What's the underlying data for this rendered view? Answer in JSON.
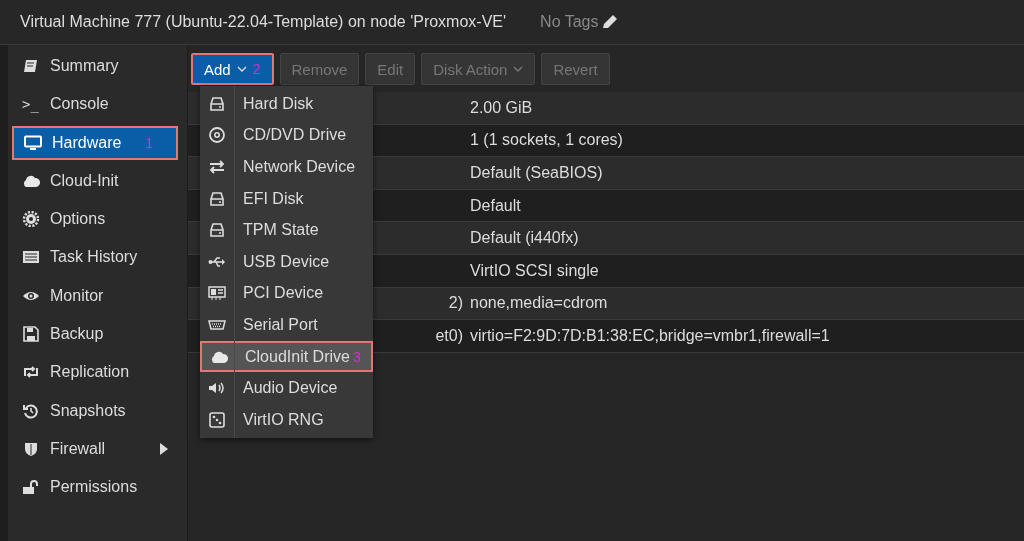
{
  "header": {
    "title": "Virtual Machine 777 (Ubuntu-22.04-Template) on node 'Proxmox-VE'",
    "tags": "No Tags"
  },
  "sidebar": {
    "items": [
      {
        "label": "Summary",
        "selected": false
      },
      {
        "label": ">_",
        "label2": "Console",
        "selected": false
      },
      {
        "label": "Hardware",
        "selected": true,
        "annotation": "1"
      },
      {
        "label": "Cloud-Init",
        "selected": false
      },
      {
        "label": "Options",
        "selected": false
      },
      {
        "label": "Task History",
        "selected": false
      },
      {
        "label": "Monitor",
        "selected": false
      },
      {
        "label": "Backup",
        "selected": false
      },
      {
        "label": "Replication",
        "selected": false
      },
      {
        "label": "Snapshots",
        "selected": false
      },
      {
        "label": "Firewall",
        "selected": false,
        "submenu": true
      },
      {
        "label": "Permissions",
        "selected": false
      }
    ]
  },
  "toolbar": {
    "buttons": [
      {
        "label": "Add",
        "kind": "primary",
        "dropdown": true,
        "disabled": false,
        "annotation": "2"
      },
      {
        "label": "Remove",
        "kind": "normal",
        "dropdown": false,
        "disabled": true
      },
      {
        "label": "Edit",
        "kind": "normal",
        "dropdown": false,
        "disabled": true
      },
      {
        "label": "Disk Action",
        "kind": "normal",
        "dropdown": true,
        "disabled": true
      },
      {
        "label": "Revert",
        "kind": "normal",
        "dropdown": false,
        "disabled": true
      }
    ]
  },
  "table": {
    "rows": [
      {
        "value": "2.00 GiB"
      },
      {
        "value": "1 (1 sockets, 1 cores)"
      },
      {
        "value": "Default (SeaBIOS)"
      },
      {
        "value": "Default"
      },
      {
        "value": "Default (i440fx)"
      },
      {
        "value": "VirtIO SCSI single"
      },
      {
        "column_1": "2)",
        "value": "none,media=cdrom"
      },
      {
        "column_1": "et0)",
        "value": "virtio=F2:9D:7D:B1:38:EC,bridge=vmbr1,firewall=1"
      }
    ]
  },
  "add_menu": {
    "items": [
      {
        "label": "Hard Disk",
        "selected": false
      },
      {
        "label": "CD/DVD Drive",
        "selected": false
      },
      {
        "label": "Network Device",
        "selected": false
      },
      {
        "label": "EFI Disk",
        "selected": false
      },
      {
        "label": "TPM State",
        "selected": false
      },
      {
        "label": "USB Device",
        "selected": false
      },
      {
        "label": "PCI Device",
        "selected": false
      },
      {
        "label": "Serial Port",
        "selected": false
      },
      {
        "label": "CloudInit Drive",
        "selected": true,
        "annotation": "3"
      },
      {
        "label": "Audio Device",
        "selected": false
      },
      {
        "label": "VirtIO RNG",
        "selected": false
      }
    ]
  }
}
